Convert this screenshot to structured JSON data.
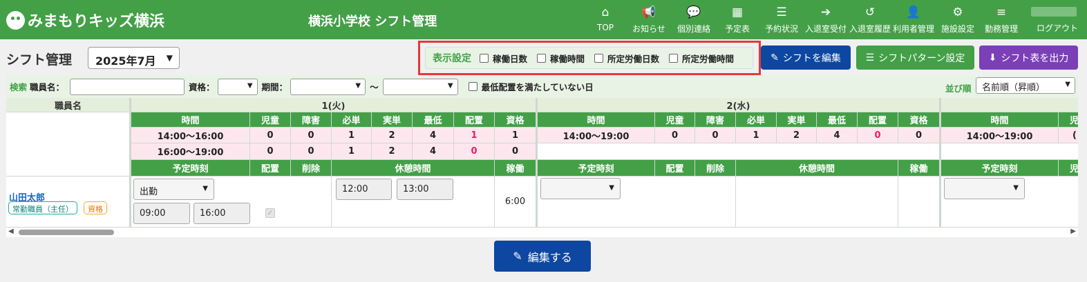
{
  "header": {
    "logo_text": "みまもりキッズ横浜",
    "app_title": "横浜小学校 シフト管理",
    "nav": [
      {
        "label": "TOP",
        "icon": "⌂"
      },
      {
        "label": "お知らせ",
        "icon": "📢"
      },
      {
        "label": "個別連絡",
        "icon": "💬"
      },
      {
        "label": "予定表",
        "icon": "▦"
      },
      {
        "label": "予約状況",
        "icon": "☰"
      },
      {
        "label": "入退室受付",
        "icon": "➔"
      },
      {
        "label": "入退室履歴",
        "icon": "↺"
      },
      {
        "label": "利用者管理",
        "icon": "👤"
      },
      {
        "label": "施設設定",
        "icon": "⚙"
      },
      {
        "label": "勤務管理",
        "icon": "≡"
      }
    ],
    "logout": "ログアウト"
  },
  "toolbar": {
    "page_title": "シフト管理",
    "month": "2025年7月",
    "display_settings_label": "表示設定",
    "display_options": [
      "稼働日数",
      "稼働時間",
      "所定労働日数",
      "所定労働時間"
    ],
    "btn_edit_shift": "シフトを編集",
    "btn_pattern": "シフトパターン設定",
    "btn_export": "シフト表を出力",
    "colors": {
      "blue": "#0d47a1",
      "green": "#43a047",
      "purple": "#7b3fb8",
      "highlight": "#e53935"
    }
  },
  "search": {
    "label": "検索",
    "staff_name_label": "職員名：",
    "qualification_label": "資格：",
    "period_label": "期間：",
    "tilde": "〜",
    "min_staff_label": "最低配置を満たしていない日",
    "sort_label": "並び順",
    "sort_value": "名前順（昇順）"
  },
  "table": {
    "staff_header": "職員名",
    "days": [
      {
        "date": "1(火)",
        "headers": [
          "時間",
          "児童",
          "障害",
          "必単",
          "実単",
          "最低",
          "配置",
          "資格"
        ],
        "rows": [
          [
            "14:00〜16:00",
            "0",
            "0",
            "1",
            "2",
            "4",
            "1",
            "1"
          ],
          [
            "16:00〜19:00",
            "0",
            "0",
            "1",
            "2",
            "4",
            "0",
            "0"
          ]
        ],
        "staff_headers": [
          "予定時刻",
          "配置",
          "削除",
          "休憩時間",
          "稼働"
        ]
      },
      {
        "date": "2(水)",
        "headers": [
          "時間",
          "児童",
          "障害",
          "必単",
          "実単",
          "最低",
          "配置",
          "資格"
        ],
        "rows": [
          [
            "14:00〜19:00",
            "0",
            "0",
            "1",
            "2",
            "4",
            "0",
            "0"
          ]
        ],
        "staff_headers": [
          "予定時刻",
          "配置",
          "削除",
          "休憩時間",
          "稼働"
        ]
      },
      {
        "headers": [
          "時間",
          "児"
        ],
        "rows": [
          [
            "14:00〜19:00",
            "("
          ]
        ],
        "staff_headers": [
          "予定時刻",
          "児"
        ]
      }
    ],
    "staff": {
      "name": "山田太郎",
      "role_badge": "常勤職員（主任）",
      "qual_badge": "資格",
      "status": "出勤",
      "start": "09:00",
      "end": "16:00",
      "break_start": "12:00",
      "break_end": "13:00",
      "work_hours": "6:00"
    }
  },
  "footer": {
    "edit_button": "編集する"
  }
}
